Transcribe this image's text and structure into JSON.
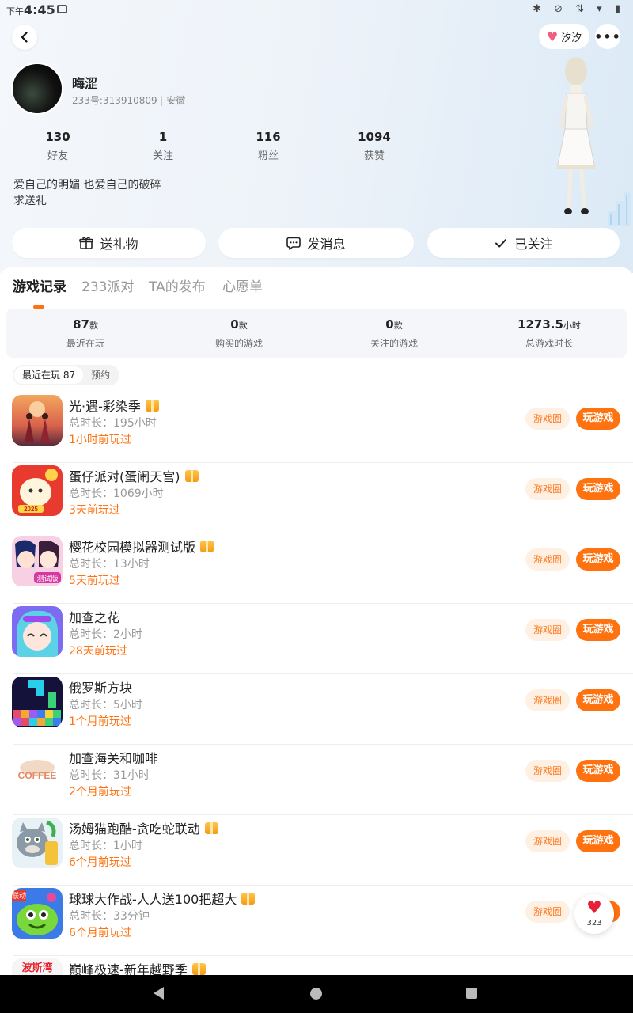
{
  "status_bar": {
    "ampm": "下午",
    "time": "4:45"
  },
  "header": {
    "nickname_chip": "汐汐"
  },
  "profile": {
    "name": "晦涩",
    "id_line": "233号:313910809",
    "region": "安徽",
    "stats": [
      {
        "value": "130",
        "label": "好友"
      },
      {
        "value": "1",
        "label": "关注"
      },
      {
        "value": "116",
        "label": "粉丝"
      },
      {
        "value": "1094",
        "label": "获赞"
      }
    ],
    "bio_line1": "爱自己的明媚 也爱自己的破碎",
    "bio_line2": "求送礼"
  },
  "actions": {
    "gift": "送礼物",
    "message": "发消息",
    "followed": "已关注"
  },
  "tabs": [
    "游戏记录",
    "233派对",
    "TA的发布",
    "心愿单"
  ],
  "summary": [
    {
      "value": "87",
      "unit": "款",
      "label": "最近在玩"
    },
    {
      "value": "0",
      "unit": "款",
      "label": "购买的游戏"
    },
    {
      "value": "0",
      "unit": "款",
      "label": "关注的游戏"
    },
    {
      "value": "1273.5",
      "unit": "小时",
      "label": "总游戏时长"
    }
  ],
  "filter": {
    "recent": "最近在玩 87",
    "reserve": "预约"
  },
  "buttons": {
    "circle": "游戏圈",
    "play": "玩游戏"
  },
  "games": [
    {
      "name": "光·遇-彩染季",
      "duration": "总时长：195小时",
      "ago": "1小时前玩过",
      "gift": true
    },
    {
      "name": "蛋仔派对(蛋闹天宫)",
      "duration": "总时长：1069小时",
      "ago": "3天前玩过",
      "gift": true
    },
    {
      "name": "樱花校园模拟器测试版",
      "duration": "总时长：13小时",
      "ago": "5天前玩过",
      "gift": true
    },
    {
      "name": "加查之花",
      "duration": "总时长：2小时",
      "ago": "28天前玩过",
      "gift": false
    },
    {
      "name": "俄罗斯方块",
      "duration": "总时长：5小时",
      "ago": "1个月前玩过",
      "gift": false
    },
    {
      "name": "加查海关和咖啡",
      "duration": "总时长：31小时",
      "ago": "2个月前玩过",
      "gift": false
    },
    {
      "name": "汤姆猫跑酷-贪吃蛇联动",
      "duration": "总时长：1小时",
      "ago": "6个月前玩过",
      "gift": true
    },
    {
      "name": "球球大作战-人人送100把超大",
      "duration": "总时长：33分钟",
      "ago": "6个月前玩过",
      "gift": true
    },
    {
      "name": "巅峰极速-新年越野季",
      "duration": "",
      "ago": "",
      "gift": true
    }
  ],
  "icon_texts": {
    "coffee": "COFFEE",
    "tag_test": "测试版",
    "tag_lian": "联动",
    "tag_bosi": "波斯湾",
    "year": "2025"
  },
  "float_like": {
    "count": "323"
  }
}
